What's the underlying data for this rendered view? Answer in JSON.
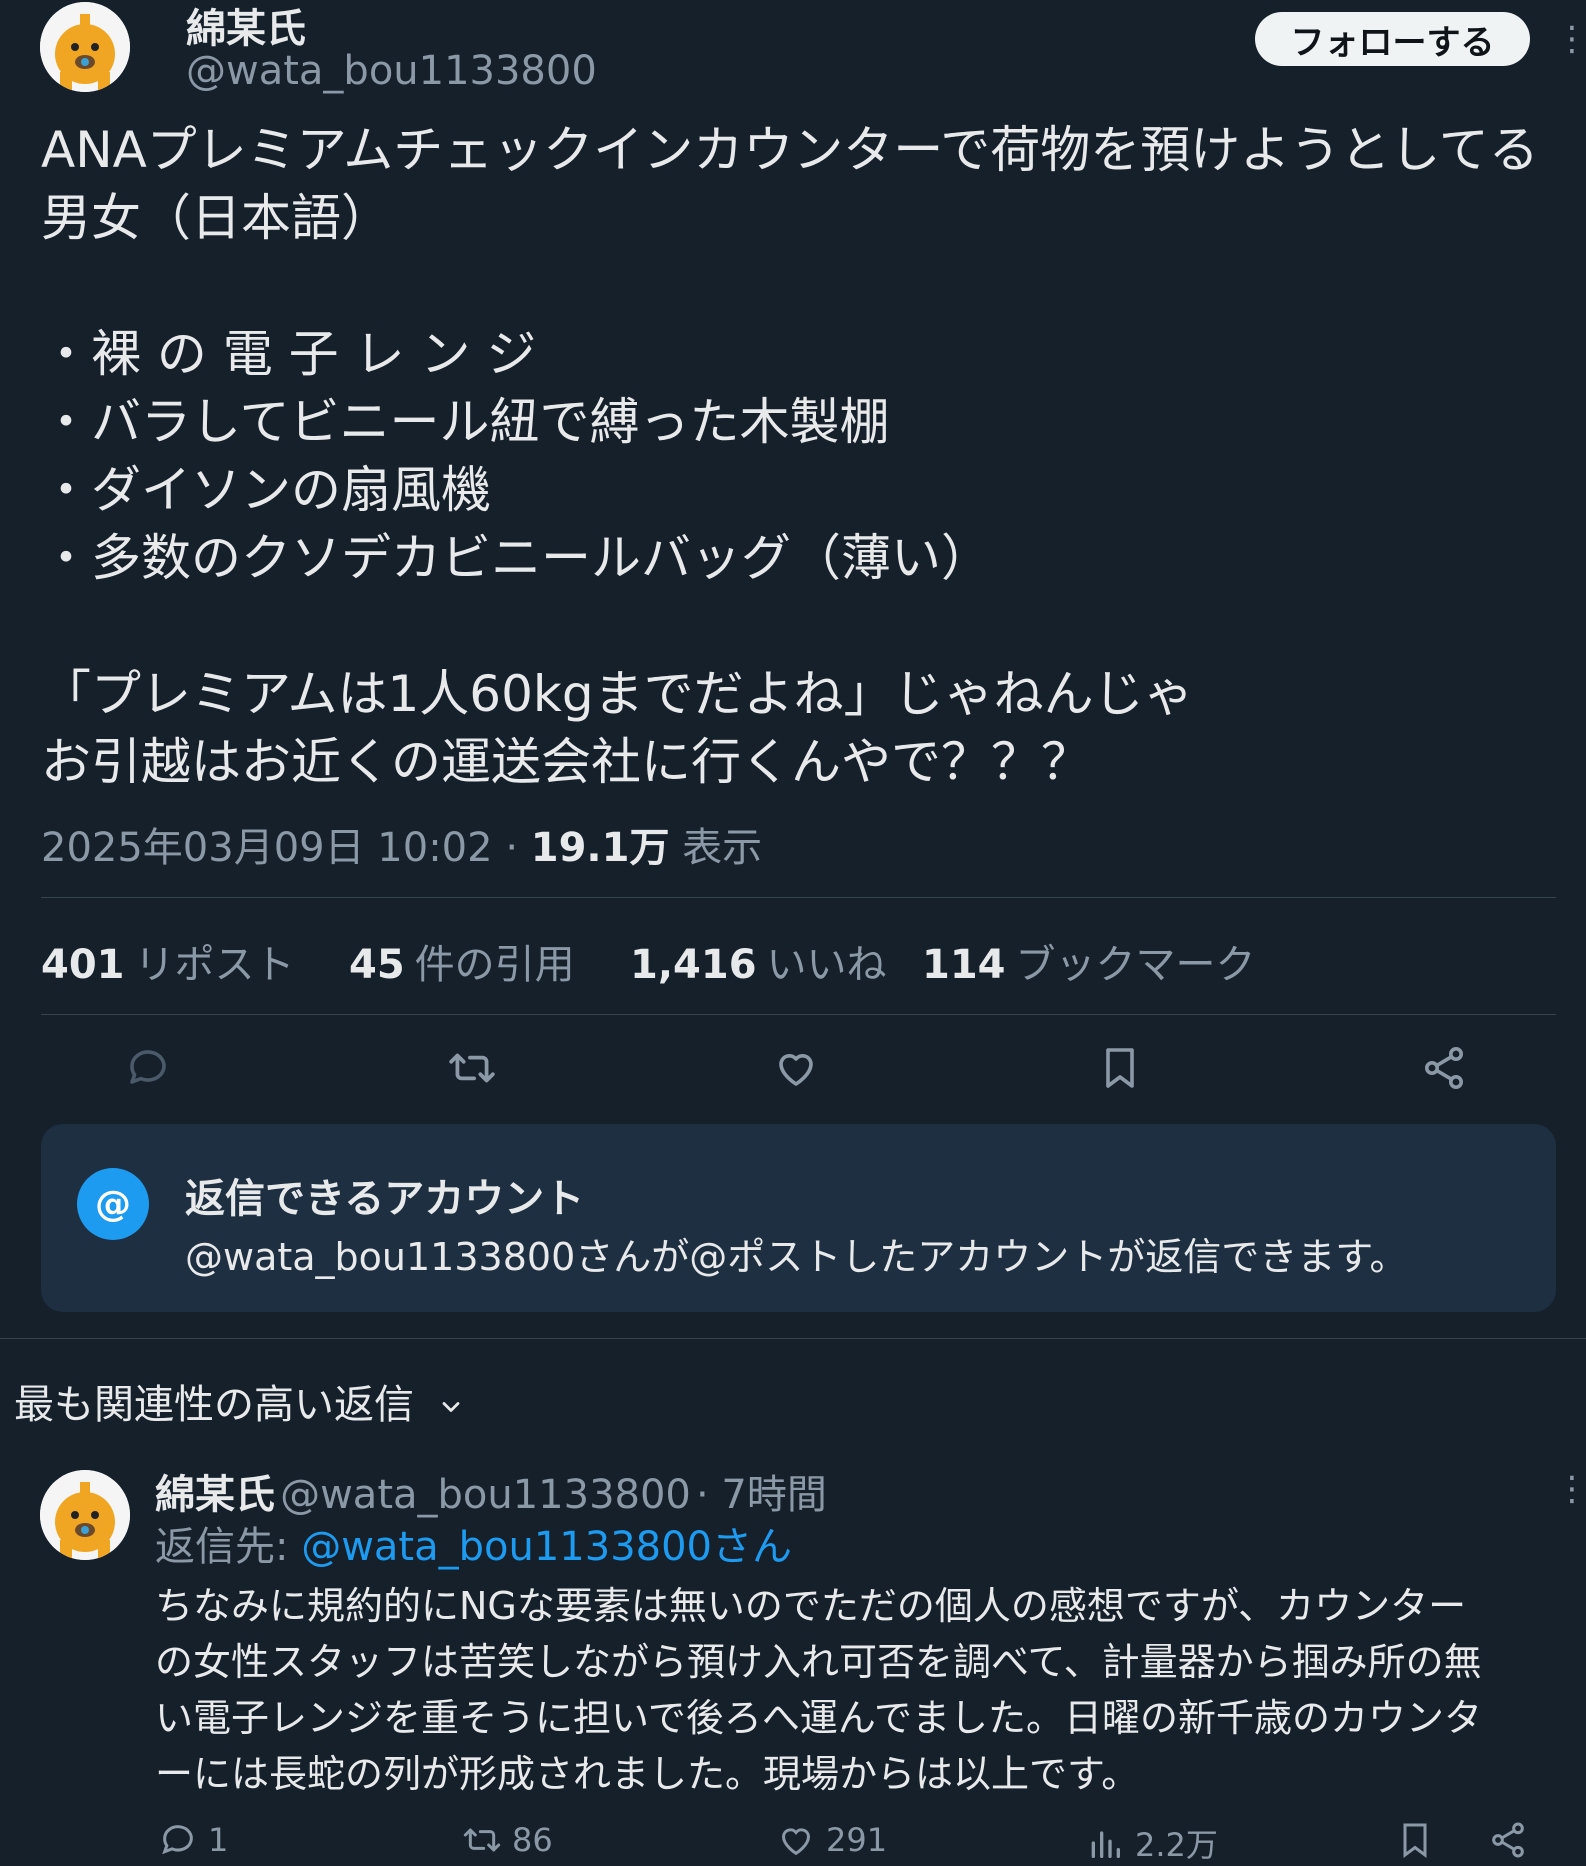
{
  "post": {
    "author_name": "綿某氏",
    "author_handle": "@wata_bou1133800",
    "follow_label": "フォローする",
    "body_lines": [
      "ANAプレミアムチェックインカウンターで荷物を預けようとしてる",
      "男女（日本語）",
      "",
      "・裸 の 電 子 レ ン ジ",
      "・バラしてビニール紐で縛った木製棚",
      "・ダイソンの扇風機",
      "・多数のクソデカビニールバッグ（薄い）",
      "",
      "「プレミアムは1人60kgまでだよね」じゃねんじゃ",
      "お引越はお近くの運送会社に行くんやで？？？"
    ],
    "timestamp": "2025年03月09日 10:02",
    "views_count": "19.1万",
    "views_label": "表示",
    "stats": [
      {
        "count": "401",
        "label": "リポスト"
      },
      {
        "count": "45",
        "label": "件の引用"
      },
      {
        "count": "1,416",
        "label": "いいね"
      },
      {
        "count": "114",
        "label": "ブックマーク"
      }
    ]
  },
  "reply_restriction": {
    "badge": "@",
    "title": "返信できるアカウント",
    "description": "@wata_bou1133800さんが@ポストしたアカウントが返信できます。"
  },
  "sort": {
    "label": "最も関連性の高い返信"
  },
  "reply": {
    "author_name": "綿某氏",
    "author_handle": "@wata_bou1133800",
    "time": "· 7時間",
    "reply_to_prefix": "返信先:",
    "reply_to_handle": "@wata_bou1133800さん",
    "body_lines": [
      "ちなみに規約的にNGな要素は無いのでただの個人の感想ですが、カウンター",
      "の女性スタッフは苦笑しながら預け入れ可否を調べて、計量器から掴み所の無",
      "い電子レンジを重そうに担いで後ろへ運んでました。日曜の新千歳のカウンタ",
      "ーには長蛇の列が形成されました。現場からは以上です。"
    ],
    "actions": {
      "replies": "1",
      "reposts": "86",
      "likes": "291",
      "views": "2.2万"
    }
  },
  "colors": {
    "background": "#15202b",
    "accent": "#1d9bf0",
    "muted": "#8b98a5",
    "divider": "#38444d"
  }
}
